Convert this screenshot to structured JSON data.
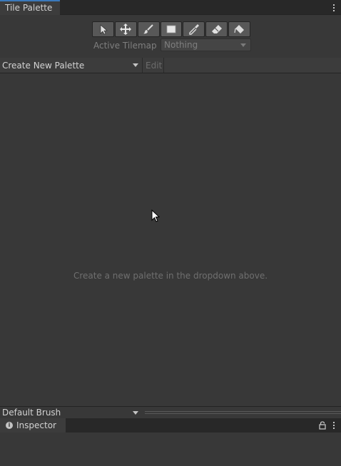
{
  "tile_palette_tab": {
    "title": "Tile Palette"
  },
  "tools": [
    {
      "name": "select-tool-icon",
      "tooltip": "Select"
    },
    {
      "name": "move-tool-icon",
      "tooltip": "Move"
    },
    {
      "name": "paintbrush-tool-icon",
      "tooltip": "Paint"
    },
    {
      "name": "box-fill-tool-icon",
      "tooltip": "Box Fill"
    },
    {
      "name": "picker-tool-icon",
      "tooltip": "Pick"
    },
    {
      "name": "eraser-tool-icon",
      "tooltip": "Erase"
    },
    {
      "name": "fill-tool-icon",
      "tooltip": "Fill"
    }
  ],
  "active_tilemap": {
    "label": "Active Tilemap",
    "value": "Nothing"
  },
  "palette_toolbar": {
    "palette_dropdown": "Create New Palette",
    "edit_label": "Edit"
  },
  "palette_area": {
    "empty_message": "Create a new palette in the dropdown above."
  },
  "brush": {
    "dropdown": "Default Brush"
  },
  "inspector_tab": {
    "title": "Inspector"
  },
  "colors": {
    "accent": "#3a79bb",
    "background": "#383838",
    "tab_bar": "#282828"
  }
}
